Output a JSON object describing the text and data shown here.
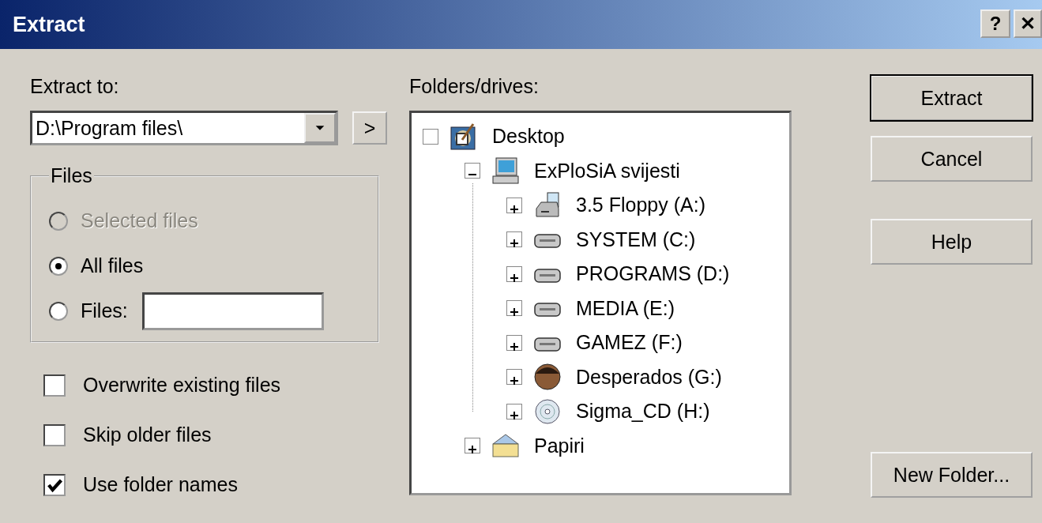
{
  "window": {
    "title": "Extract",
    "title_buttons": [
      {
        "label": "?",
        "kind": "help"
      },
      {
        "label": "✕",
        "kind": "close"
      }
    ]
  },
  "extract_to": {
    "label": "Extract to:",
    "value": "D:\\Program files\\",
    "browse_button": ">"
  },
  "files_group": {
    "title": "Files",
    "options": [
      {
        "label": "Selected files",
        "selected": false,
        "disabled": true,
        "kind": "plain"
      },
      {
        "label": "All files",
        "selected": true,
        "disabled": false,
        "kind": "plain"
      },
      {
        "label": "Files:",
        "selected": false,
        "disabled": false,
        "kind": "with_field"
      }
    ]
  },
  "options": [
    {
      "label": "Overwrite existing files",
      "checked": false
    },
    {
      "label": "Skip older files",
      "checked": false
    },
    {
      "label": "Use folder names",
      "checked": true
    }
  ],
  "tree": {
    "label": "Folders/drives:",
    "items": [
      {
        "label": "Desktop",
        "kind": "desktop",
        "children": [
          {
            "label": "ExPloSiA svijesti",
            "kind": "computer",
            "expanded": true,
            "children": [
              {
                "label": "3.5 Floppy (A:)",
                "kind": "floppy",
                "expanded": false
              },
              {
                "label": "SYSTEM (C:)",
                "kind": "drive",
                "expanded": false
              },
              {
                "label": "PROGRAMS (D:)",
                "kind": "drive",
                "expanded": false
              },
              {
                "label": "MEDIA (E:)",
                "kind": "drive",
                "expanded": false
              },
              {
                "label": "GAMEZ (F:)",
                "kind": "drive",
                "expanded": false
              },
              {
                "label": "Desperados (G:)",
                "kind": "emblem",
                "expanded": false
              },
              {
                "label": "Sigma_CD (H:)",
                "kind": "cd",
                "expanded": false
              }
            ]
          },
          {
            "label": "Papiri",
            "kind": "folder",
            "expanded": false
          }
        ]
      }
    ]
  },
  "buttons": [
    {
      "label": "Extract",
      "default": true
    },
    {
      "label": "Cancel",
      "default": false
    },
    {
      "label": "Help",
      "default": false
    }
  ],
  "bottom_buttons": [
    {
      "label": "New Folder...",
      "default": false
    }
  ]
}
